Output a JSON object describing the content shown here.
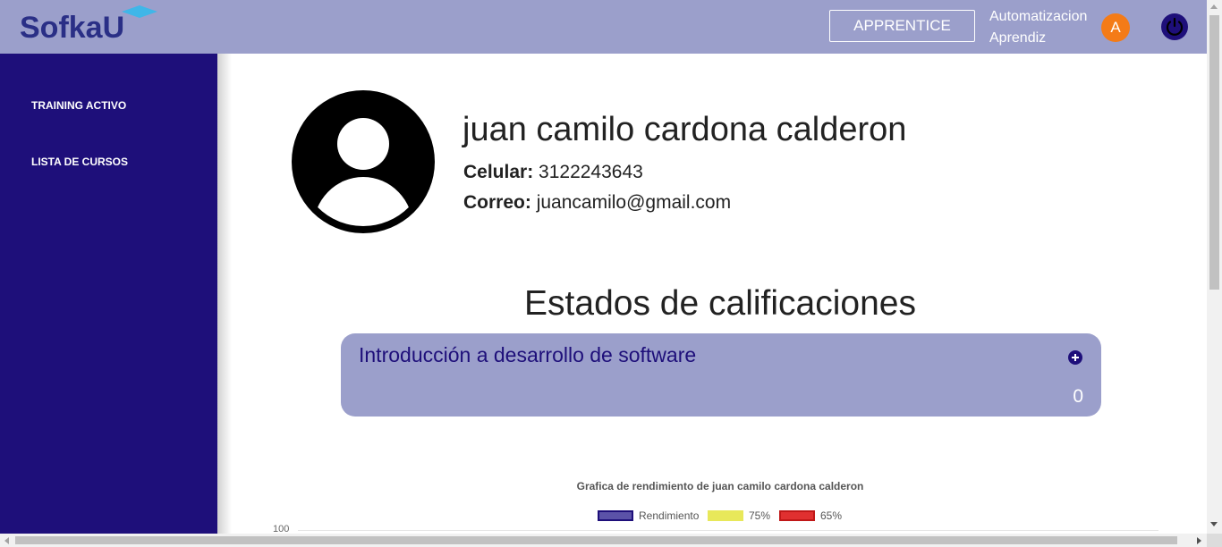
{
  "header": {
    "logo_text": "SofkaU",
    "role_button": "APPRENTICE",
    "user_line1": "Automatizacion",
    "user_line2": "Aprendiz",
    "avatar_initial": "A",
    "colors": {
      "bar": "#9b9fcb",
      "avatar": "#f47b17"
    }
  },
  "sidebar": {
    "items": [
      {
        "label": "TRAINING ACTIVO"
      },
      {
        "label": "LISTA DE CURSOS"
      }
    ],
    "color": "#1e0f7a"
  },
  "profile": {
    "name": "juan camilo cardona calderon",
    "celular_label": "Celular:",
    "celular_value": "3122243643",
    "correo_label": "Correo:",
    "correo_value": "juancamilo@gmail.com"
  },
  "grades": {
    "section_title": "Estados de calificaciones",
    "courses": [
      {
        "title": "Introducción a desarrollo de software",
        "score": "0"
      }
    ]
  },
  "chart_data": {
    "type": "bar",
    "title": "Grafica de rendimiento de juan camilo cardona calderon",
    "series": [
      {
        "name": "Rendimiento",
        "color": "#5b52a8",
        "border": "#1e0f7a"
      },
      {
        "name": "75%",
        "color": "#e8e85a",
        "border": "#e8e85a"
      },
      {
        "name": "65%",
        "color": "#e03030",
        "border": "#c01818"
      }
    ],
    "y_tick_top": "100",
    "ylim": [
      0,
      100
    ]
  }
}
